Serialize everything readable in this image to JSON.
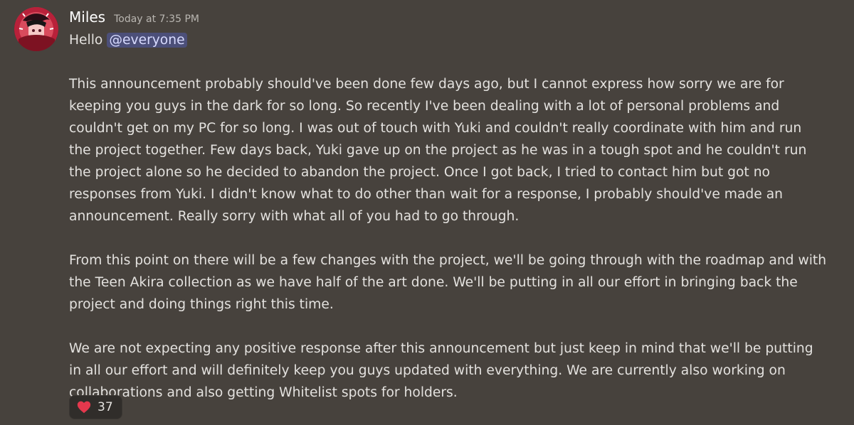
{
  "message": {
    "author": "Miles",
    "timestamp": "Today at 7:35 PM",
    "greeting": "Hello",
    "mention": "@everyone",
    "lines": [
      "This announcement probably should've been done few days ago, but I cannot express how sorry we are for",
      "keeping you guys in the dark for so long. So recently I've been dealing with a lot of personal problems and",
      "couldn't get on my PC for so long. I was out of touch with Yuki and couldn't really coordinate with him and run",
      "the project together. Few days back, Yuki gave up on the project as he was in a tough spot and he couldn't run",
      "the project alone so he decided to abandon the project. Once I got back, I tried to contact him but got no",
      "responses from Yuki. I didn't know what to do other than wait for a response, I probably should've made an",
      "announcement. Really sorry with what all of you had to go through.",
      "",
      "From this point on there will be a few changes with the project, we'll be going through with the roadmap and with",
      "the Teen Akira collection as we have half of the art done. We'll be putting in all our effort in bringing back the",
      "project and doing things right this time.",
      "",
      "We are not expecting any positive response after this announcement but just keep in mind that we'll be putting",
      "in all our effort and will definitely keep you guys updated with everything. We are currently also working on",
      "collaborations and also getting Whitelist spots for holders."
    ],
    "reaction": {
      "icon": "heart-icon",
      "count": "37",
      "color": "#e4384d"
    }
  },
  "colors": {
    "background": "#47423d",
    "text": "#e3e1de",
    "mention_bg": "#4c4f79",
    "mention_text": "#d8dbff",
    "reaction_bg": "#302d2a"
  }
}
